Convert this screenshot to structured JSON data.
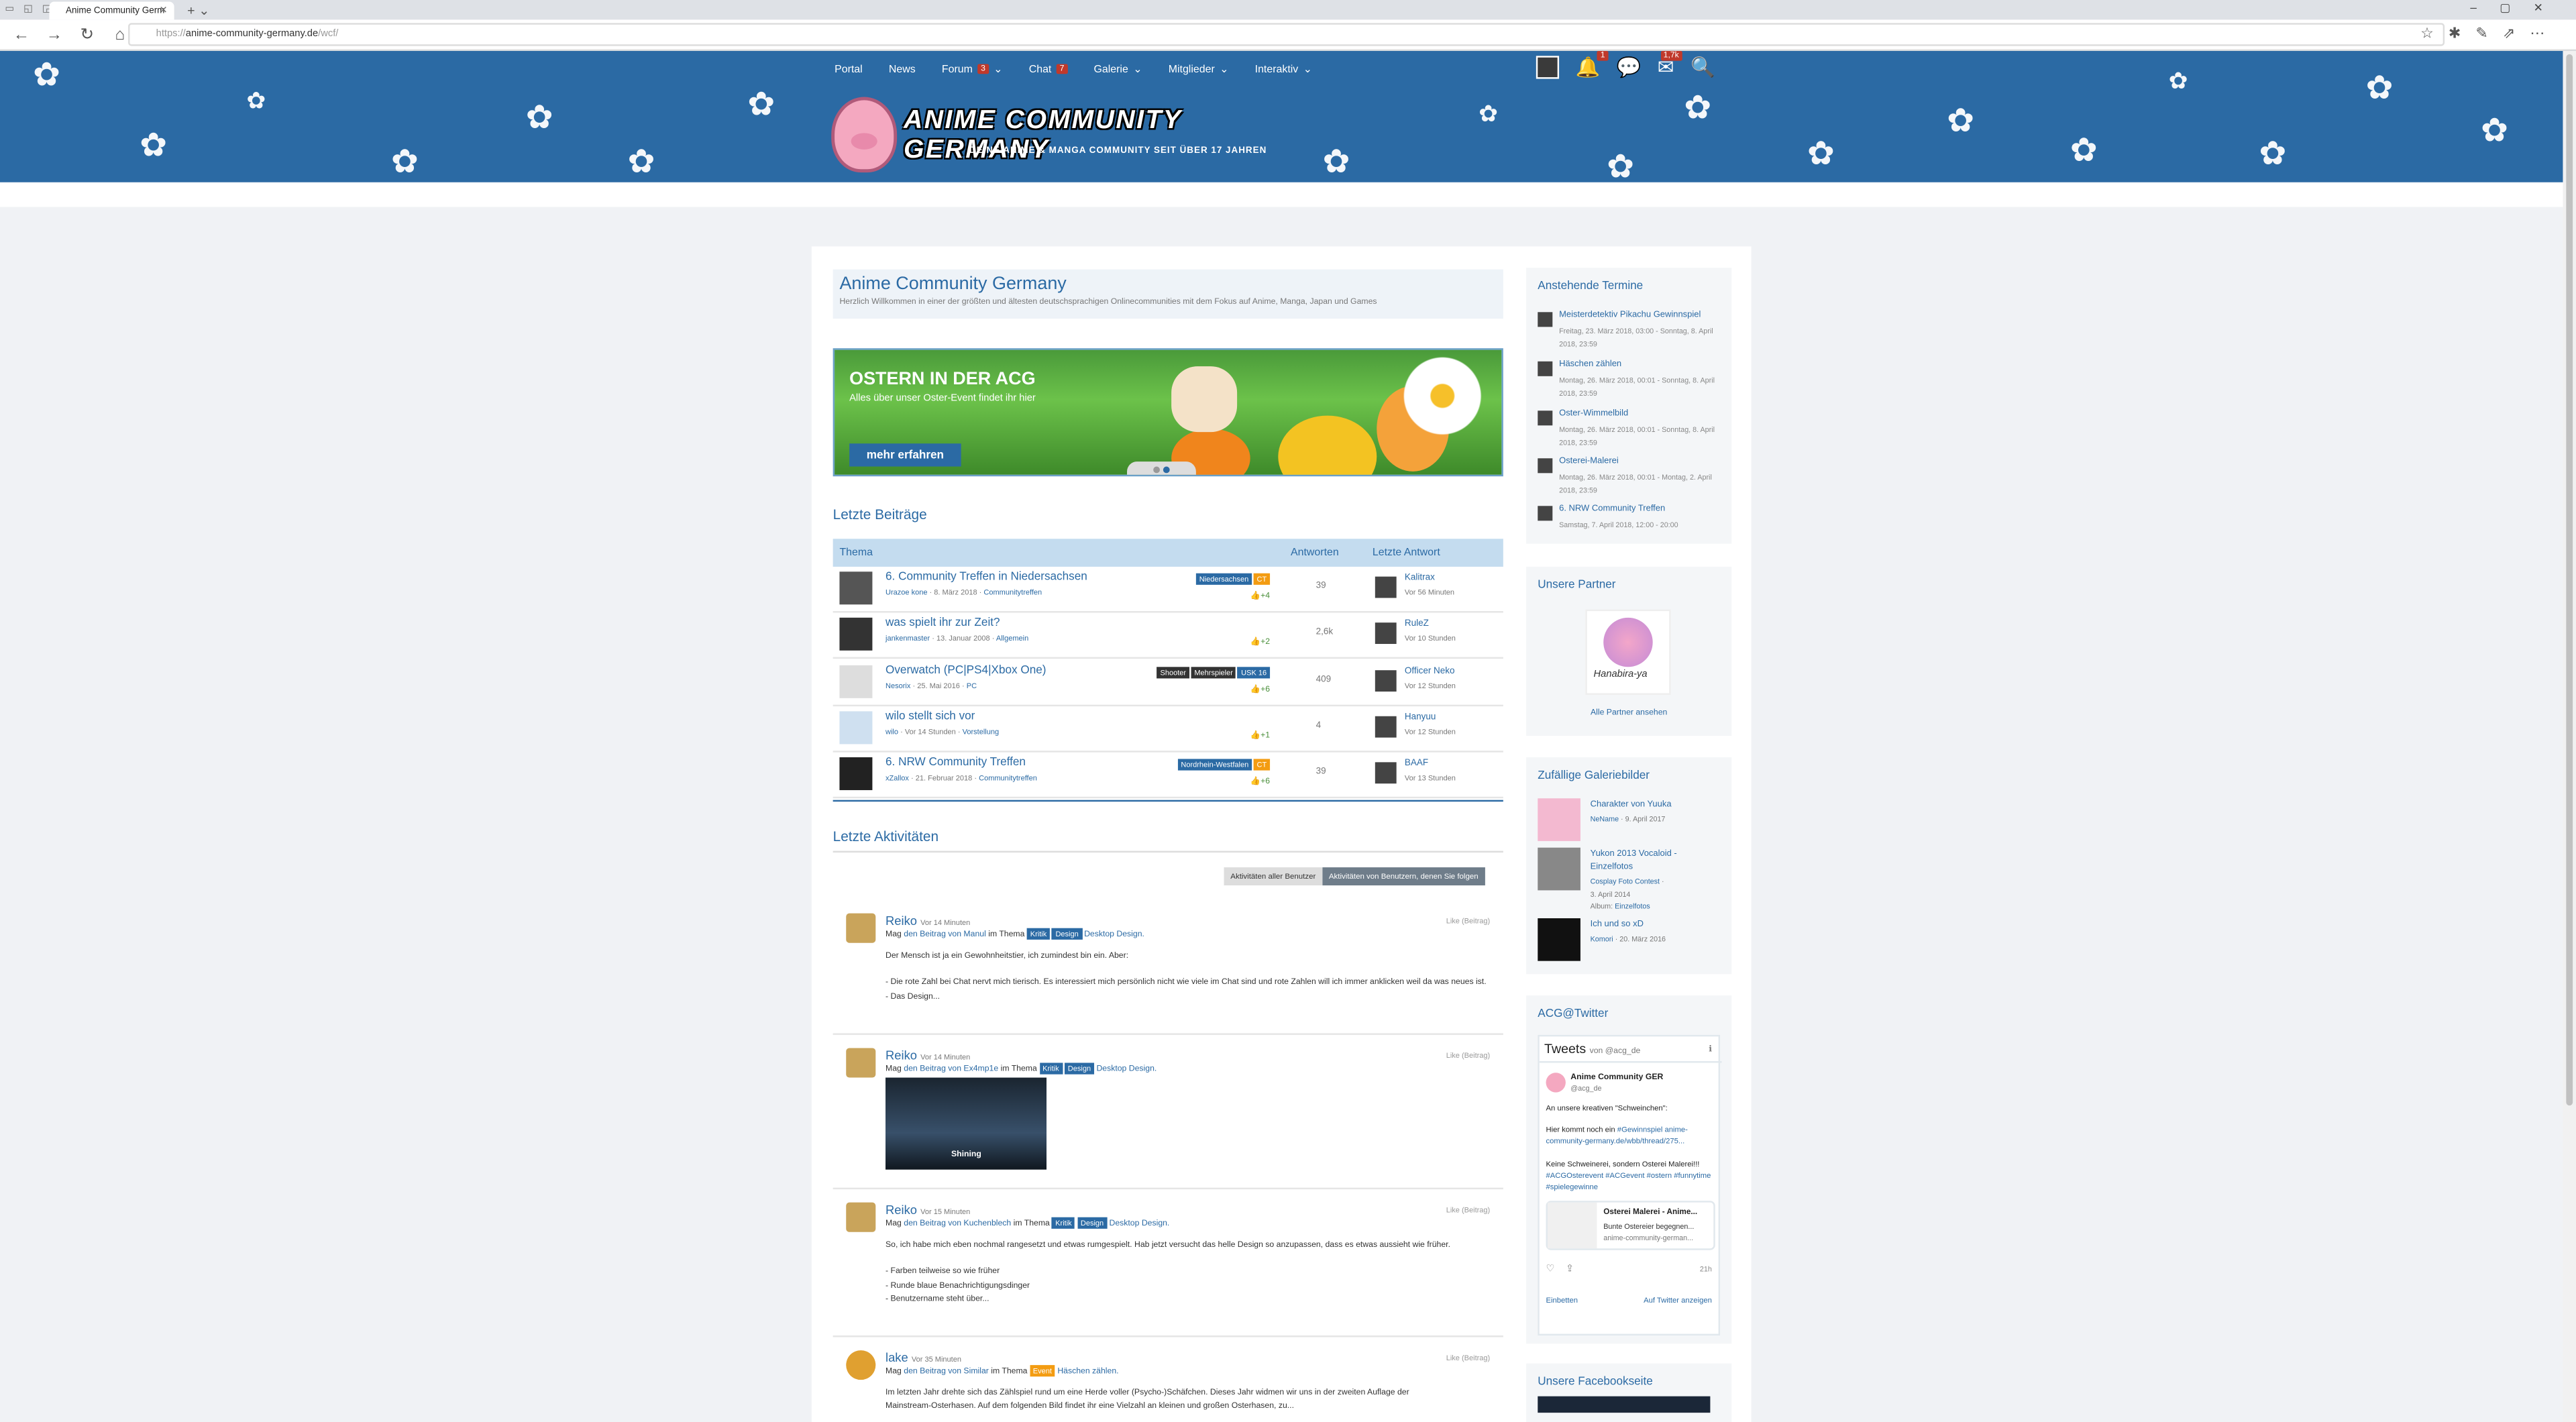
{
  "browser": {
    "tab_title": "Anime Community Germ",
    "url_prefix": "https://",
    "url_host": "anime-community-germany.de",
    "url_path": "/wcf/"
  },
  "nav": {
    "items": [
      {
        "label": "Portal"
      },
      {
        "label": "News"
      },
      {
        "label": "Forum",
        "badge": "3"
      },
      {
        "label": "Chat",
        "badge": "7"
      },
      {
        "label": "Galerie"
      },
      {
        "label": "Mitglieder"
      },
      {
        "label": "Interaktiv"
      }
    ],
    "notifications_badge": "1",
    "conversations_badge": "1,7k"
  },
  "logo": {
    "title": "ANIME COMMUNITY GERMANY",
    "subtitle": "DEINE ANIME & MANGA COMMUNITY SEIT ÜBER 17 JAHREN"
  },
  "welcome": {
    "title": "Anime Community Germany",
    "text": "Herzlich Willkommen in einer der größten und ältesten deutschsprachigen Onlinecommunities mit dem Fokus auf Anime, Manga, Japan und Games"
  },
  "banner": {
    "title": "OSTERN IN DER ACG",
    "subtitle": "Alles über unser Oster-Event findet ihr hier",
    "button": "mehr erfahren"
  },
  "posts": {
    "title": "Letzte Beiträge",
    "col_topic": "Thema",
    "col_answers": "Antworten",
    "col_last": "Letzte Antwort",
    "rows": [
      {
        "title": "6. Community Treffen in Niedersachsen",
        "author": "Urazoe kone",
        "date": "8. März 2018",
        "board": "Communitytreffen",
        "tags": [
          {
            "t": "Niedersachsen",
            "c": "blue"
          },
          {
            "t": "CT",
            "c": "orange"
          }
        ],
        "likes": "+4",
        "answers": "39",
        "last_user": "Kalitrax",
        "last_time": "Vor 56 Minuten"
      },
      {
        "title": "was spielt ihr zur Zeit?",
        "author": "jankenmaster",
        "date": "13. Januar 2008",
        "board": "Allgemein",
        "tags": [],
        "likes": "+2",
        "answers": "2,6k",
        "last_user": "RuleZ",
        "last_time": "Vor 10 Stunden"
      },
      {
        "title": "Overwatch (PC|PS4|Xbox One)",
        "author": "Nesorix",
        "date": "25. Mai 2016",
        "board": "PC",
        "tags": [
          {
            "t": "Shooter",
            "c": "dark"
          },
          {
            "t": "Mehrspieler",
            "c": "dark"
          },
          {
            "t": "USK 16",
            "c": "blue"
          }
        ],
        "likes": "+6",
        "answers": "409",
        "last_user": "Officer Neko",
        "last_time": "Vor 12 Stunden"
      },
      {
        "title": "wilo stellt sich vor",
        "author": "wilo",
        "date": "Vor 14 Stunden",
        "board": "Vorstellung",
        "tags": [],
        "likes": "+1",
        "answers": "4",
        "last_user": "Hanyuu",
        "last_time": "Vor 12 Stunden"
      },
      {
        "title": "6. NRW Community Treffen",
        "author": "xZallox",
        "date": "21. Februar 2018",
        "board": "Communitytreffen",
        "tags": [
          {
            "t": "Nordrhein-Westfalen",
            "c": "blue"
          },
          {
            "t": "CT",
            "c": "orange"
          }
        ],
        "likes": "+6",
        "answers": "39",
        "last_user": "BAAF",
        "last_time": "Vor 13 Stunden"
      }
    ]
  },
  "activities": {
    "title": "Letzte Aktivitäten",
    "btn_all": "Aktivitäten aller Benutzer",
    "btn_follow": "Aktivitäten von Benutzern, denen Sie folgen",
    "items": [
      {
        "name": "Reiko",
        "time": "Vor 14 Minuten",
        "like": "Like (Beitrag)",
        "pre": "Mag",
        "post_link": "den Beitrag von Manul",
        "mid": "im Thema",
        "tags": [
          "Kritik",
          "Design"
        ],
        "topic": "Desktop Design.",
        "body": [
          "Der Mensch ist ja ein Gewohnheitstier, ich zumindest bin ein. Aber:",
          "",
          "- Die rote Zahl bei Chat nervt mich tierisch. Es interessiert mich persönlich nicht wie viele im Chat sind und rote Zahlen will ich immer anklicken weil da was neues ist.",
          "- Das Design..."
        ]
      },
      {
        "name": "Reiko",
        "time": "Vor 14 Minuten",
        "like": "Like (Beitrag)",
        "pre": "Mag",
        "post_link": "den Beitrag von Ex4mp1e",
        "mid": "im Thema",
        "tags": [
          "Kritik",
          "Design"
        ],
        "topic": "Desktop Design.",
        "image_caption": "Shining"
      },
      {
        "name": "Reiko",
        "time": "Vor 15 Minuten",
        "like": "Like (Beitrag)",
        "pre": "Mag",
        "post_link": "den Beitrag von Kuchenblech",
        "mid": "im Thema",
        "tags": [
          "Kritik",
          "Design"
        ],
        "topic": "Desktop Design.",
        "body": [
          "So, ich habe mich eben nochmal rangesetzt und etwas rumgespielt. Hab jetzt versucht das helle Design so anzupassen, dass es etwas aussieht wie früher.",
          "",
          "- Farben teilweise so wie früher",
          "- Runde blaue Benachrichtigungsdinger",
          "- Benutzername steht über..."
        ]
      },
      {
        "name": "lake",
        "time": "Vor 35 Minuten",
        "like": "Like (Beitrag)",
        "pre": "Mag",
        "post_link": "den Beitrag von Similar",
        "mid": "im Thema",
        "tags_event": "Event",
        "topic": "Häschen zählen.",
        "body": [
          "Im letzten Jahr drehte sich das Zählspiel rund um eine Herde voller (Psycho-)Schäfchen. Dieses Jahr widmen wir uns in der zweiten Auflage der",
          "Mainstream-Osterhasen. Auf dem folgenden Bild findet ihr eine Vielzahl an kleinen und großen Osterhasen, zu..."
        ]
      }
    ]
  },
  "sidebar": {
    "events_title": "Anstehende Termine",
    "events": [
      {
        "title": "Meisterdetektiv Pikachu Gewinnspiel",
        "date": "Freitag, 23. März 2018, 03:00 - Sonntag, 8. April 2018, 23:59"
      },
      {
        "title": "Häschen zählen",
        "date": "Montag, 26. März 2018, 00:01 - Sonntag, 8. April 2018, 23:59"
      },
      {
        "title": "Oster-Wimmelbild",
        "date": "Montag, 26. März 2018, 00:01 - Sonntag, 8. April 2018, 23:59"
      },
      {
        "title": "Osterei-Malerei",
        "date": "Montag, 26. März 2018, 00:01 - Montag, 2. April 2018, 23:59"
      },
      {
        "title": "6. NRW Community Treffen",
        "date": "Samstag, 7. April 2018, 12:00 - 20:00"
      }
    ],
    "partner_title": "Unsere Partner",
    "partner_name": "Hanabira-ya",
    "partner_link": "Alle Partner ansehen",
    "gallery_title": "Zufällige Galeriebilder",
    "gallery": [
      {
        "title": "Charakter von Yuuka",
        "user": "NeName",
        "date": "9. April 2017"
      },
      {
        "title": "Yukon 2013 Vocaloid - Einzelfotos",
        "user": "Cosplay Foto Contest",
        "date": "3. April 2014",
        "album_label": "Album:",
        "album": "Einzelfotos"
      },
      {
        "title": "Ich und so xD",
        "user": "Komori",
        "date": "20. März 2016"
      }
    ],
    "twitter_title": "ACG@Twitter",
    "tweets_head": "Tweets",
    "tweets_by": "von @acg_de",
    "tw_name": "Anime Community GER",
    "tw_handle": "@acg_de",
    "tw_line1": "An unsere kreativen \"Schweinchen\":",
    "tw_line2a": "Hier kommt noch ein ",
    "tw_line2b": "#Gewinnspiel",
    "tw_line2c": "anime-community-germany.de/wbb/thread/275...",
    "tw_line3a": "Keine Schweinerei, sondern Osterei Malerei!!!",
    "tw_line3b": "#ACGOsterevent #ACGevent",
    "tw_line3c": "#ostern",
    "tw_line3d": "#funnytime #spielegewinne",
    "card_title": "Osterei Malerei - Anime...",
    "card_desc": "Bunte Ostereier begegnen...",
    "card_url": "anime-community-german...",
    "tw_time": "21h",
    "tw_embed": "Einbetten",
    "tw_view": "Auf Twitter anzeigen",
    "facebook_title": "Unsere Facebookseite"
  }
}
